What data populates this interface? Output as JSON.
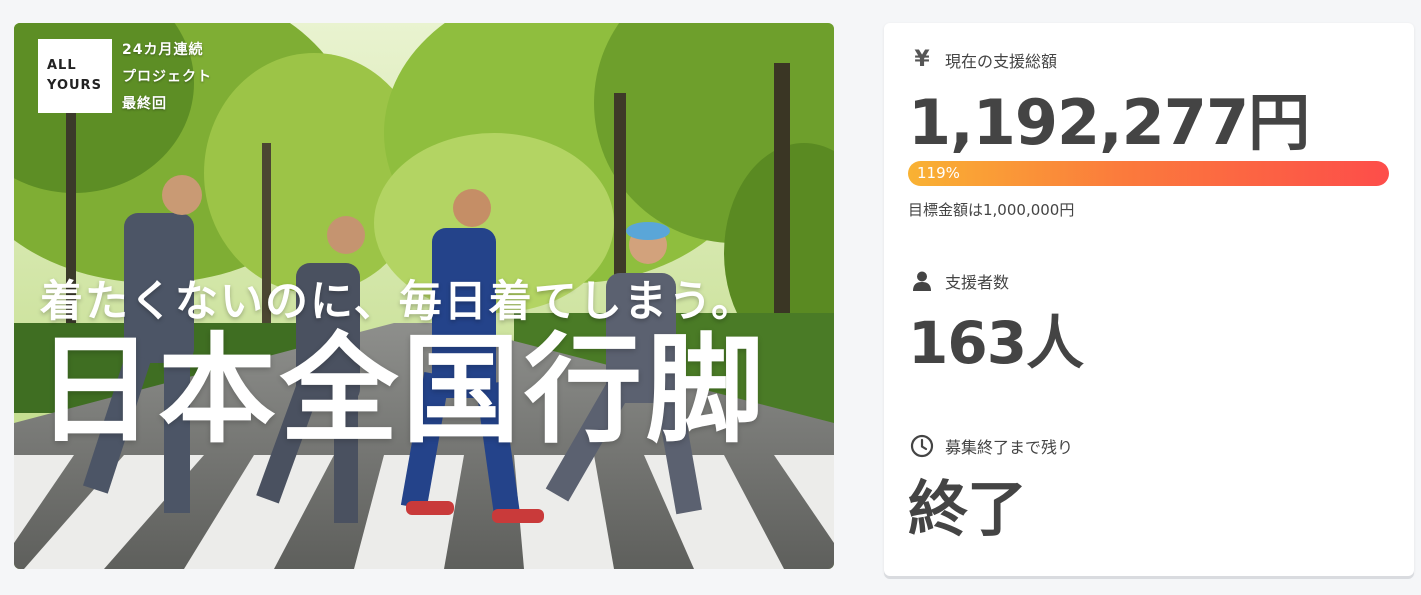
{
  "hero": {
    "logo_line1": "ALL",
    "logo_line2": "YOURS",
    "series_line1": "24カ月連続",
    "series_line2": "プロジェクト",
    "series_line3": "最終回",
    "catchphrase": "着たくないのに、毎日着てしまう。",
    "title": "日本全国行脚"
  },
  "stats": {
    "amount": {
      "icon": "yen-icon",
      "icon_glyph": "¥",
      "label": "現在の支援総額",
      "value": "1,192,277円",
      "percent_text": "119%",
      "percent": 119,
      "goal_text": "目標金額は1,000,000円"
    },
    "supporters": {
      "icon": "person-icon",
      "label": "支援者数",
      "value": "163人"
    },
    "remaining": {
      "icon": "clock-icon",
      "label": "募集終了まで残り",
      "value": "終了"
    }
  },
  "colors": {
    "progress_start": "#f9b233",
    "progress_end": "#fd4d4a",
    "text": "#444444",
    "background": "#f5f6f8"
  }
}
